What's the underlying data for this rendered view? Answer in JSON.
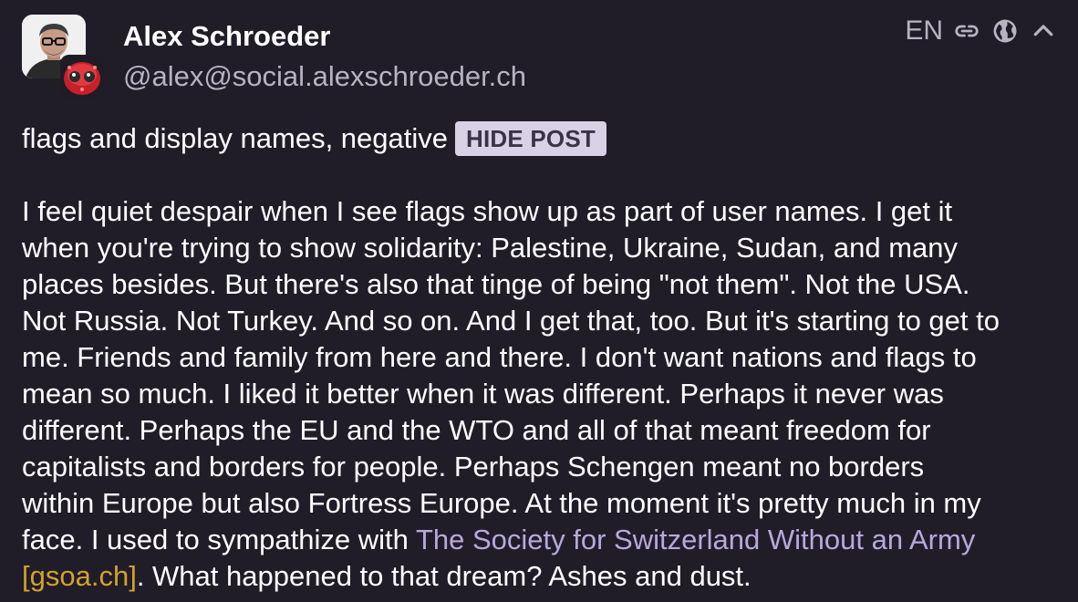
{
  "author": {
    "display_name": "Alex Schroeder",
    "handle": "@alex@social.alexschroeder.ch",
    "avatar_icon": "avatar-photo",
    "instance_icon": "instance-avatar"
  },
  "header_tools": {
    "language": "EN",
    "link_icon": "link-icon",
    "visibility_icon": "globe-icon",
    "collapse_icon": "chevron-up-icon"
  },
  "content_warning": {
    "text": "flags and display names, negative",
    "button_label": "HIDE POST"
  },
  "body": {
    "lines": [
      "I feel quiet despair when I see flags show up as part of user names. I get it",
      "when you're trying to show solidarity: Palestine, Ukraine, Sudan, and many",
      "places besides. But there's also that tinge of being \"not them\". Not the USA.",
      "Not Russia. Not Turkey. And so on. And I get that, too. But it's starting to get to",
      "me. Friends and family from here and there. I don't want nations and flags to",
      "mean so much. I liked it better when it was different. Perhaps it never was",
      "different. Perhaps the EU and the WTO and all of that meant freedom for",
      "capitalists and borders for people. Perhaps Schengen meant no borders",
      "within Europe but also Fortress Europe. At the moment it's pretty much in my"
    ],
    "line_10_prefix": "face. I used to sympathize with ",
    "link_text": "The Society for Switzerland Without an Army",
    "link_domain": "[gsoa.ch]",
    "closing_text": ". What happened to that dream? Ashes and dust."
  },
  "colors": {
    "background": "#201d29",
    "text": "#ffffff",
    "muted": "#b7b3c3",
    "link": "#b9a8dc",
    "domain": "#d4a12a",
    "button_bg": "#d9d1e6",
    "button_text": "#3a3449"
  }
}
